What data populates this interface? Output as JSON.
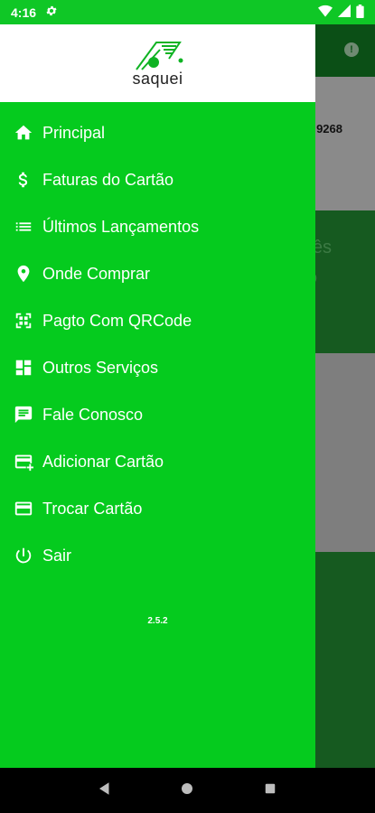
{
  "status_bar": {
    "time": "4:16"
  },
  "background": {
    "card_number": "9268",
    "banner_text_1": "ês",
    "banner_text_2": "o"
  },
  "drawer": {
    "logo_text": "saquei",
    "menu": [
      {
        "label": "Principal",
        "icon": "home-icon"
      },
      {
        "label": "Faturas do Cartão",
        "icon": "dollar-icon"
      },
      {
        "label": "Últimos Lançamentos",
        "icon": "list-icon"
      },
      {
        "label": "Onde Comprar",
        "icon": "location-pin-icon"
      },
      {
        "label": "Pagto Com QRCode",
        "icon": "qrcode-icon"
      },
      {
        "label": "Outros Serviços",
        "icon": "dashboard-icon"
      },
      {
        "label": "Fale Conosco",
        "icon": "chat-icon"
      },
      {
        "label": "Adicionar Cartão",
        "icon": "add-card-icon"
      },
      {
        "label": "Trocar Cartão",
        "icon": "credit-card-icon"
      },
      {
        "label": "Sair",
        "icon": "power-icon"
      }
    ],
    "version": "2.5.2"
  },
  "colors": {
    "drawer_green": "#05cb1e",
    "status_green": "#0fc726",
    "dark_green": "#0b4f16"
  }
}
